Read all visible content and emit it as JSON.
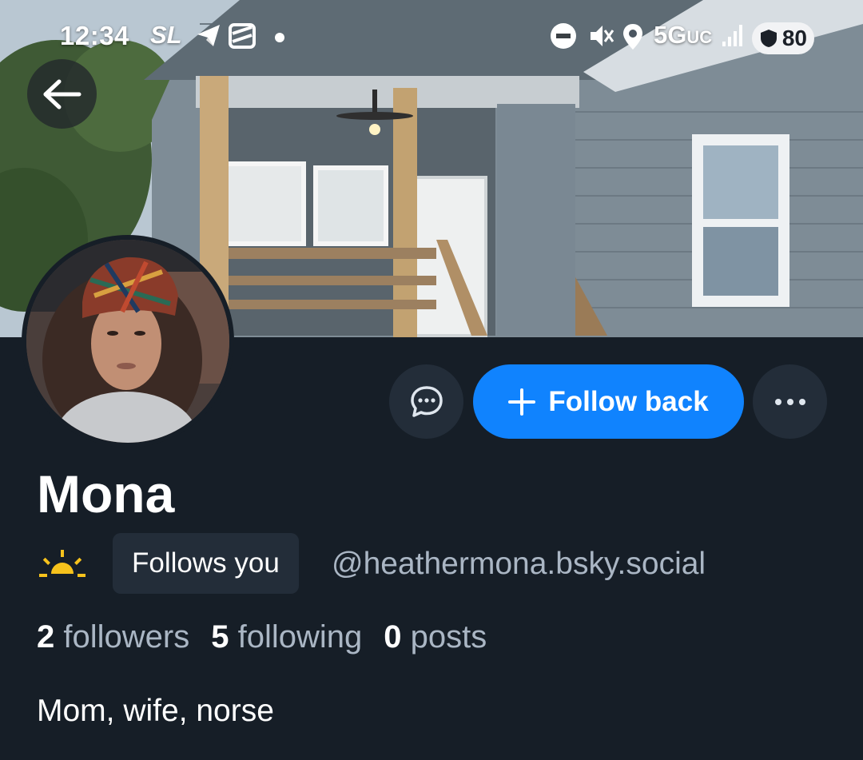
{
  "status_bar": {
    "time": "12:34",
    "carrier": "SL",
    "network": "5G",
    "network_suffix": "UC",
    "battery": "80",
    "icons": [
      "telegram-icon",
      "stack-icon",
      "dot-icon",
      "do-not-disturb-icon",
      "vibrate-icon",
      "location-icon",
      "signal-icon",
      "battery-icon"
    ]
  },
  "header": {
    "back_icon": "arrow-left-icon"
  },
  "actions": {
    "message_icon": "chat-bubble-icon",
    "follow_label": "Follow back",
    "follow_icon": "plus-icon",
    "more_icon": "ellipsis-icon"
  },
  "profile": {
    "display_name": "Mona",
    "status_emoji": "sunrise-icon",
    "follows_you_label": "Follows you",
    "handle": "@heathermona.bsky.social",
    "stats": {
      "followers_count": "2",
      "followers_label": "followers",
      "following_count": "5",
      "following_label": "following",
      "posts_count": "0",
      "posts_label": "posts"
    },
    "bio": "Mom, wife, norse"
  },
  "colors": {
    "background": "#161e27",
    "accent": "#1083fe",
    "muted_text": "#aab6c4",
    "chip_background": "#232d39",
    "sun": "#f6c21c"
  }
}
